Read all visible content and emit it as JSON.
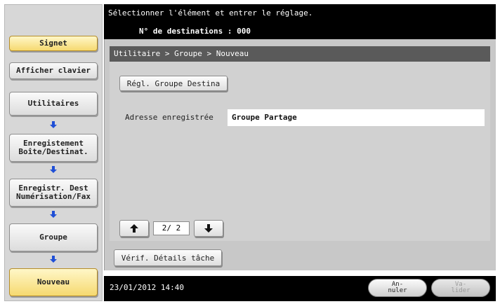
{
  "header": {
    "instruction": "Sélectionner l'élément et entrer le réglage.",
    "destinations": "N° de destinations  :   000"
  },
  "sidebar": {
    "bookmark": "Signet",
    "show_keyboard": "Afficher clavier",
    "steps": [
      {
        "label": "Utilitaires"
      },
      {
        "label": "Enregistement\nBoîte/Destinat."
      },
      {
        "label": "Enregistr. Dest\nNumérisation/Fax"
      },
      {
        "label": "Groupe"
      },
      {
        "label": "Nouveau"
      }
    ]
  },
  "breadcrumb": "Utilitaire > Groupe > Nouveau",
  "main": {
    "group_dest_button": "Régl. Groupe Destina",
    "field_label": "Adresse enregistrée",
    "field_value": "Groupe Partage",
    "page_indicator": "2/ 2",
    "check_job_button": "Vérif. Détails tâche"
  },
  "footer": {
    "datetime": "23/01/2012   14:40",
    "cancel": "An-\nnuler",
    "validate": "Va-\nlider"
  },
  "colors": {
    "accent_yellow": "#f6d970",
    "arrow_blue": "#1f4fd6",
    "header_bg": "#000000"
  }
}
